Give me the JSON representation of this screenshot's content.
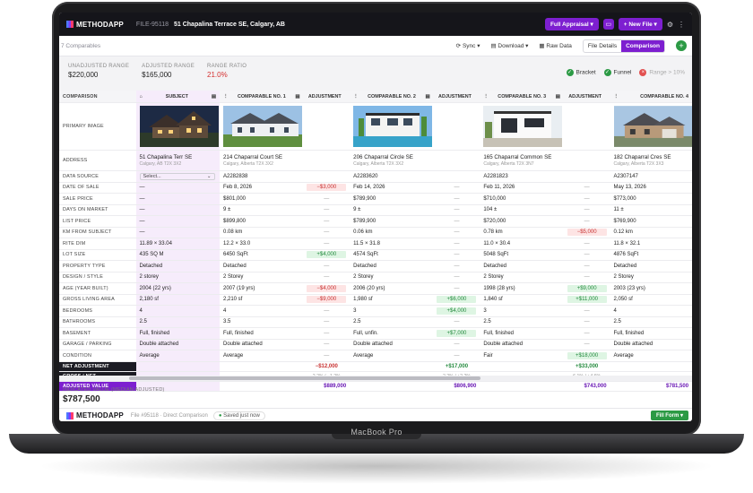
{
  "device": {
    "brand": "MacBook Pro"
  },
  "topbar": {
    "logo_text": "METHODAPP",
    "file_id": "FILE-95118",
    "address": "51 Chapalina Terrace SE, Calgary, AB",
    "full_appraisal": "Full Appraisal",
    "new_file": "+ New File"
  },
  "toolbar": {
    "comparables_count": "7 Comparables",
    "sync": "Sync",
    "download": "Download",
    "raw_data": "Raw Data",
    "file_details": "File Details",
    "comparison": "Comparison",
    "add": "+"
  },
  "summary": {
    "unadjusted_label": "UNADJUSTED RANGE",
    "unadjusted_value": "$220,000",
    "adjusted_label": "ADJUSTED RANGE",
    "adjusted_value": "$165,000",
    "ratio_label": "RANGE RATIO",
    "ratio_value": "21.0%",
    "legend": {
      "bracket": "Bracket",
      "funnel": "Funnel",
      "range": "Range > 10%"
    }
  },
  "headers": {
    "comparison": "COMPARISON",
    "subject": "SUBJECT",
    "comp1": "COMPARABLE NO. 1",
    "adj": "ADJUSTMENT",
    "comp2": "COMPARABLE NO. 2",
    "comp3": "COMPARABLE NO. 3",
    "comp4": "COMPARABLE NO. 4"
  },
  "row_labels": {
    "image": "PRIMARY IMAGE",
    "address": "ADDRESS",
    "source": "DATA SOURCE",
    "date": "DATE OF SALE",
    "price": "SALE PRICE",
    "dom": "DAYS ON MARKET",
    "list": "LIST PRICE",
    "km": "KM FROM SUBJECT",
    "lot_dim": "RITE DIM",
    "lot_size": "LOT SIZE",
    "ptype": "PROPERTY TYPE",
    "style": "DESIGN / STYLE",
    "age": "AGE (YEAR BUILT)",
    "gla": "GROSS LIVING AREA",
    "beds": "BEDROOMS",
    "baths": "BATHROOMS",
    "basement": "BASEMENT",
    "garage": "GARAGE / PARKING",
    "condition": "CONDITION",
    "net_adj": "NET ADJUSTMENT",
    "gross_net": "GROSS / NET",
    "adj_value": "ADJUSTED VALUE"
  },
  "subject": {
    "address": "51 Chapalina Terr SE",
    "city": "Calgary, AB T2X 3X2",
    "source": "Select...",
    "date": "—",
    "price": "—",
    "dom": "—",
    "list": "—",
    "km": "—",
    "lot_dim": "11.89 × 33.04",
    "lot_size": "435 SQ M",
    "ptype": "Detached",
    "style": "2 storey",
    "age": "2004 (22 yrs)",
    "gla": "2,180 sf",
    "beds": "4",
    "baths": "2.5",
    "basement": "Full, finished",
    "garage": "Double attached",
    "condition": "Average"
  },
  "comps": [
    {
      "address": "214 Chaparral Court SE",
      "city": "Calgary, Alberta T2X 3X2",
      "source": "A2282838",
      "date": "Feb 8, 2026",
      "price": "$801,000",
      "dom": "9 ±",
      "list": "$899,800",
      "km": "0.08 km",
      "lot_dim": "12.2 × 33.0",
      "lot_size": "6450 SqFt",
      "ptype": "Detached",
      "style": "2 Storey",
      "age": "2007 (19 yrs)",
      "gla": "2,210 sf",
      "beds": "4",
      "baths": "3.5",
      "basement": "Full, finished",
      "garage": "Double attached",
      "condition": "Average",
      "adj": {
        "date": "−$3,000",
        "price": "—",
        "dom": "—",
        "list": "—",
        "km": "—",
        "lot_dim": "—",
        "lot_size": "+$4,000",
        "ptype": "—",
        "style": "—",
        "age": "−$4,000",
        "gla": "−$9,000",
        "beds": "—",
        "baths": "—",
        "basement": "—",
        "garage": "—",
        "condition": "—"
      },
      "net": "−$12,000",
      "gross": "2.2% / −1.2%",
      "adjusted": "$889,000"
    },
    {
      "address": "206 Chaparral Circle SE",
      "city": "Calgary, Alberta T2X 3X2",
      "source": "A2283620",
      "date": "Feb 14, 2026",
      "price": "$789,900",
      "dom": "9 ±",
      "list": "$789,900",
      "km": "0.06 km",
      "lot_dim": "11.5 × 31.8",
      "lot_size": "4574 SqFt",
      "ptype": "Detached",
      "style": "2 Storey",
      "age": "2006 (20 yrs)",
      "gla": "1,980 sf",
      "beds": "3",
      "baths": "2.5",
      "basement": "Full, unfin.",
      "garage": "Double attached",
      "condition": "Average",
      "adj": {
        "date": "—",
        "price": "—",
        "dom": "—",
        "list": "—",
        "km": "—",
        "lot_dim": "—",
        "lot_size": "—",
        "ptype": "—",
        "style": "—",
        "age": "—",
        "gla": "+$6,000",
        "beds": "+$4,000",
        "baths": "—",
        "basement": "+$7,000",
        "garage": "—",
        "condition": "—"
      },
      "net": "+$17,000",
      "gross": "2.2% / +2.2%",
      "adjusted": "$806,900"
    },
    {
      "address": "165 Chaparral Common SE",
      "city": "Calgary, Alberta T2X 3N7",
      "source": "A2281823",
      "date": "Feb 11, 2026",
      "price": "$710,000",
      "dom": "104 ±",
      "list": "$720,000",
      "km": "0.78 km",
      "lot_dim": "11.0 × 30.4",
      "lot_size": "5048 SqFt",
      "ptype": "Detached",
      "style": "2 Storey",
      "age": "1998 (28 yrs)",
      "gla": "1,840 sf",
      "beds": "3",
      "baths": "2.5",
      "basement": "Full, finished",
      "garage": "Double attached",
      "condition": "Fair",
      "adj": {
        "date": "—",
        "price": "—",
        "dom": "—",
        "list": "—",
        "km": "−$5,000",
        "lot_dim": "—",
        "lot_size": "—",
        "ptype": "—",
        "style": "—",
        "age": "+$9,000",
        "gla": "+$11,000",
        "beds": "—",
        "baths": "—",
        "basement": "—",
        "garage": "—",
        "condition": "+$18,000"
      },
      "net": "+$33,000",
      "gross": "6.1% / +4.6%",
      "adjusted": "$743,000"
    },
    {
      "address": "182 Chaparral Cres SE",
      "city": "Calgary, Alberta T2X 3X3",
      "source": "A2307147",
      "date": "May 13, 2026",
      "price": "$773,000",
      "dom": "11 ±",
      "list": "$769,900",
      "km": "0.12 km",
      "lot_dim": "11.8 × 32.1",
      "lot_size": "4876 SqFt",
      "ptype": "Detached",
      "style": "2 Storey",
      "age": "2003 (23 yrs)",
      "gla": "2,050 sf",
      "beds": "4",
      "baths": "2.5",
      "basement": "Full, finished",
      "garage": "Double attached",
      "condition": "Average",
      "adjusted": "$781,500"
    }
  ],
  "indicated": {
    "label": "INDICATED VALUE (MEDIAN ADJUSTED)",
    "value": "$787,500"
  },
  "footer": {
    "file": "File #95118 · Direct Comparison",
    "saved": "Saved",
    "saved_when": "just now",
    "fill_form": "Fill Form"
  }
}
